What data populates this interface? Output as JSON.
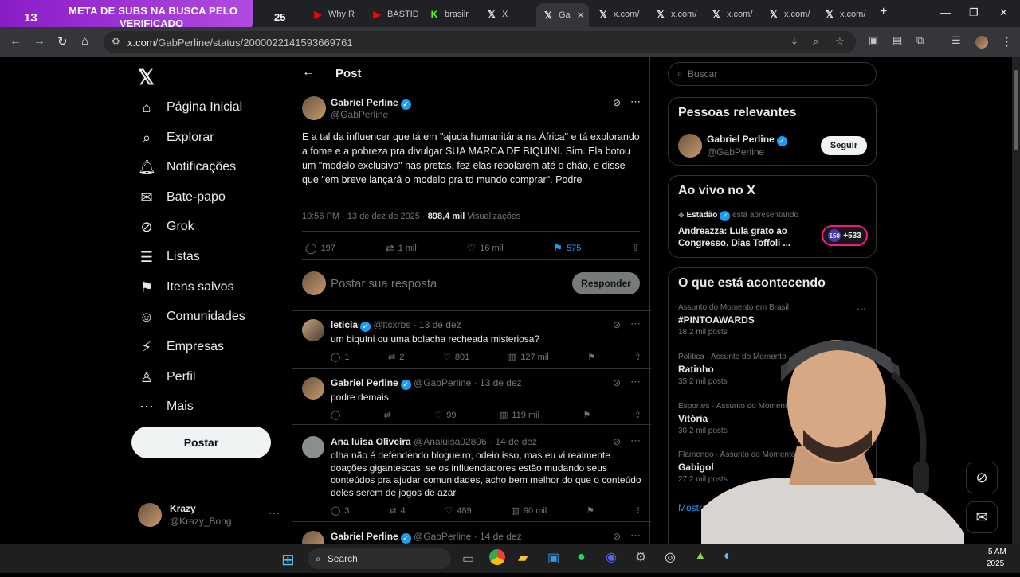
{
  "banner": {
    "count": "13",
    "line1": "META DE SUBS NA BUSCA PELO",
    "line2": "VERIFICADO",
    "goal": "25"
  },
  "tabs": [
    {
      "label": "Why R"
    },
    {
      "label": "BASTID"
    },
    {
      "label": "brasilr"
    },
    {
      "label": "X"
    },
    {
      "label": "Ga",
      "active": true
    },
    {
      "label": "x.com/"
    },
    {
      "label": "x.com/"
    },
    {
      "label": "x.com/"
    },
    {
      "label": "x.com/"
    },
    {
      "label": "x.com/"
    }
  ],
  "addressbar": {
    "host": "x.com",
    "path": "/GabPerline/status/2000022141593669761"
  },
  "nav": {
    "items": [
      {
        "label": "Página Inicial",
        "icon": "home-icon"
      },
      {
        "label": "Explorar",
        "icon": "search-icon"
      },
      {
        "label": "Notificações",
        "icon": "bell-icon"
      },
      {
        "label": "Bate-papo",
        "icon": "mail-icon"
      },
      {
        "label": "Grok",
        "icon": "grok-icon"
      },
      {
        "label": "Listas",
        "icon": "list-icon"
      },
      {
        "label": "Itens salvos",
        "icon": "bookmark-icon"
      },
      {
        "label": "Comunidades",
        "icon": "communities-icon"
      },
      {
        "label": "Empresas",
        "icon": "lightning-icon"
      },
      {
        "label": "Perfil",
        "icon": "person-icon"
      },
      {
        "label": "Mais",
        "icon": "more-icon"
      }
    ],
    "post_button": "Postar",
    "account": {
      "name": "Krazy",
      "handle": "@Krazy_Bong"
    }
  },
  "main": {
    "header": "Post",
    "post": {
      "author": "Gabriel Perline",
      "handle": "@GabPerline",
      "text": "E a tal da influencer que tá em \"ajuda humanitária na África\" e tá explorando a fome e a pobreza pra divulgar SUA MARCA DE BIQUÍNI. Sim. Ela botou um \"modelo exclusivo\" nas pretas, fez elas rebolarem até o chão, e disse que \"em breve lançará o modelo pra td mundo comprar\". Podre",
      "time": "10:56 PM · 13 de dez de 2025 ·",
      "views_count": "898,4 mil",
      "views_label": "Visualizações",
      "replies": "197",
      "reposts": "1 mil",
      "likes": "16 mil",
      "bookmarks": "575"
    },
    "compose": {
      "placeholder": "Postar sua resposta",
      "button": "Responder"
    },
    "replies": [
      {
        "name": "leticia",
        "handle": "@ltcxrbs",
        "date": "· 13 de dez",
        "text": "um biquíni ou uma bolacha recheada misteriosa?",
        "replies": "1",
        "reposts": "2",
        "likes": "801",
        "views": "127 mil"
      },
      {
        "name": "Gabriel Perline",
        "handle": "@GabPerline",
        "date": "· 13 de dez",
        "text": "podre demais",
        "replies": "",
        "reposts": "",
        "likes": "99",
        "views": "119 mil"
      },
      {
        "name": "Ana luisa Oliveira",
        "handle": "@Analuisa02806",
        "date": "· 14 de dez",
        "text": "olha não é defendendo blogueiro, odeio isso, mas eu vi realmente doações gigantescas, se os influenciadores estão mudando seus conteúdos pra ajudar comunidades, acho bem melhor do que o conteúdo deles serem de jogos de azar",
        "replies": "3",
        "reposts": "4",
        "likes": "489",
        "views": "90 mil"
      },
      {
        "name": "Gabriel Perline",
        "handle": "@GabPerline",
        "date": "· 14 de dez",
        "text": ""
      }
    ]
  },
  "right": {
    "search_placeholder": "Buscar",
    "relevant": {
      "title": "Pessoas relevantes",
      "name": "Gabriel Perline",
      "handle": "@GabPerline",
      "follow": "Seguir"
    },
    "live": {
      "title": "Ao vivo no X",
      "host": "Estadão",
      "status": "está apresentando",
      "headline": "Andreazza: Lula grato ao Congresso. Dias Toffoli ...",
      "listeners": "+533",
      "badge": "150"
    },
    "trends": {
      "title": "O que está acontecendo",
      "items": [
        {
          "context": "Assunto do Momento em Brasil",
          "name": "#PINTOAWARDS",
          "count": "18,2 mil posts"
        },
        {
          "context": "Política · Assunto do Momento",
          "name": "Ratinho",
          "count": "35,2 mil posts"
        },
        {
          "context": "Esportes · Assunto do Momento",
          "name": "Vitória",
          "count": "30,2 mil posts"
        },
        {
          "context": "Flamengo · Assunto do Momento",
          "name": "Gabigol",
          "count": "27,2 mil posts"
        }
      ],
      "more": "Mostrar mais"
    }
  },
  "taskbar": {
    "search": "Search",
    "time": "5 AM",
    "date": "2025"
  }
}
